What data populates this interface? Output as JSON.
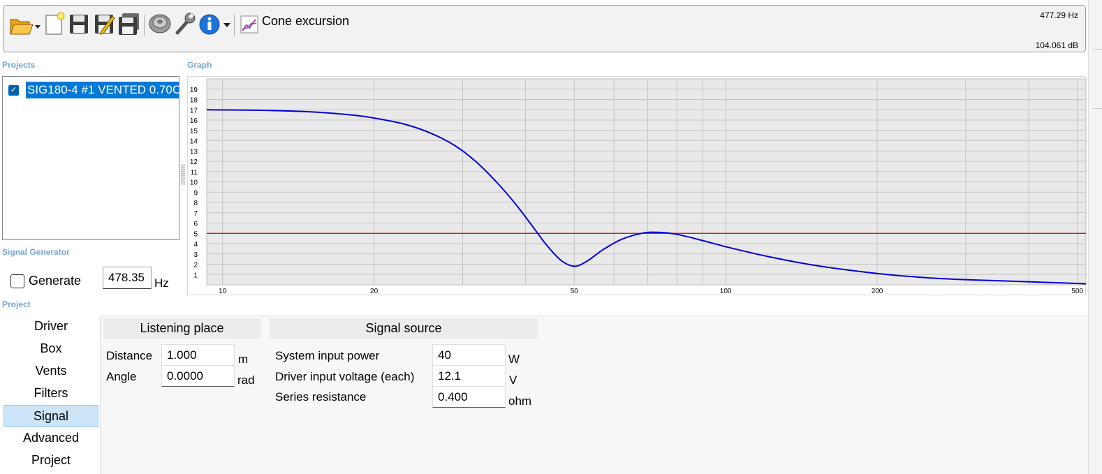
{
  "toolbar": {
    "title": "Cone excursion",
    "frequency_readout": "477.29 Hz",
    "level_readout": "104.061 dB",
    "icons": [
      "open-folder-icon",
      "new-document-icon",
      "save-icon",
      "edit-save-icon",
      "save-all-icon",
      "speaker-icon",
      "wrench-icon",
      "info-icon",
      "chart-icon"
    ]
  },
  "labels": {
    "projects": "Projects",
    "graph": "Graph",
    "signal_generator": "Signal Generator",
    "project": "Project"
  },
  "projects": {
    "items": [
      {
        "name": "SIG180-4 #1 VENTED 0.70C",
        "checked": true
      }
    ]
  },
  "signal_generator": {
    "generate_label": "Generate",
    "generate_checked": false,
    "frequency": "478.35",
    "unit": "Hz"
  },
  "chart_data": {
    "type": "line",
    "title": "",
    "xlabel": "",
    "ylabel": "",
    "x_scale": "log",
    "xlim": [
      9.3,
      520
    ],
    "ylim": [
      0,
      20
    ],
    "x_ticks": [
      10,
      20,
      50,
      100,
      200,
      500
    ],
    "x_grid": [
      10,
      20,
      30,
      40,
      50,
      60,
      70,
      80,
      90,
      100,
      200,
      300,
      400,
      500
    ],
    "y_ticks": [
      1,
      2,
      3,
      4,
      5,
      6,
      7,
      8,
      9,
      10,
      11,
      12,
      13,
      14,
      15,
      16,
      17,
      18,
      19
    ],
    "grid": true,
    "series": [
      {
        "color": "#0000dd",
        "x": [
          9.3,
          12,
          15,
          18,
          20,
          23,
          26,
          29,
          32,
          35,
          38,
          41,
          44,
          47,
          50,
          53,
          57,
          62,
          68,
          73,
          80,
          90,
          100,
          120,
          150,
          200,
          250,
          300,
          400,
          520
        ],
        "y": [
          17.0,
          16.95,
          16.8,
          16.5,
          16.2,
          15.6,
          14.7,
          13.5,
          11.9,
          10.0,
          8.0,
          5.9,
          3.9,
          2.4,
          1.8,
          2.3,
          3.4,
          4.4,
          5.0,
          5.1,
          4.9,
          4.3,
          3.7,
          2.8,
          1.9,
          1.1,
          0.7,
          0.5,
          0.3,
          0.1
        ]
      }
    ],
    "reference_line": {
      "y": 5,
      "color": "#cc0000"
    }
  },
  "nav": {
    "items": [
      "Driver",
      "Box",
      "Vents",
      "Filters",
      "Signal",
      "Advanced",
      "Project"
    ],
    "active": "Signal"
  },
  "listening_place": {
    "heading": "Listening place",
    "distance_label": "Distance",
    "distance_value": "1.000",
    "distance_unit": "m",
    "angle_label": "Angle",
    "angle_value": "0.0000",
    "angle_unit": "rad"
  },
  "signal_source": {
    "heading": "Signal source",
    "power_label": "System input power",
    "power_value": "40",
    "power_unit": "W",
    "voltage_label": "Driver input voltage (each)",
    "voltage_value": "12.1",
    "voltage_unit": "V",
    "resistance_label": "Series resistance",
    "resistance_value": "0.400",
    "resistance_unit": "ohm"
  }
}
